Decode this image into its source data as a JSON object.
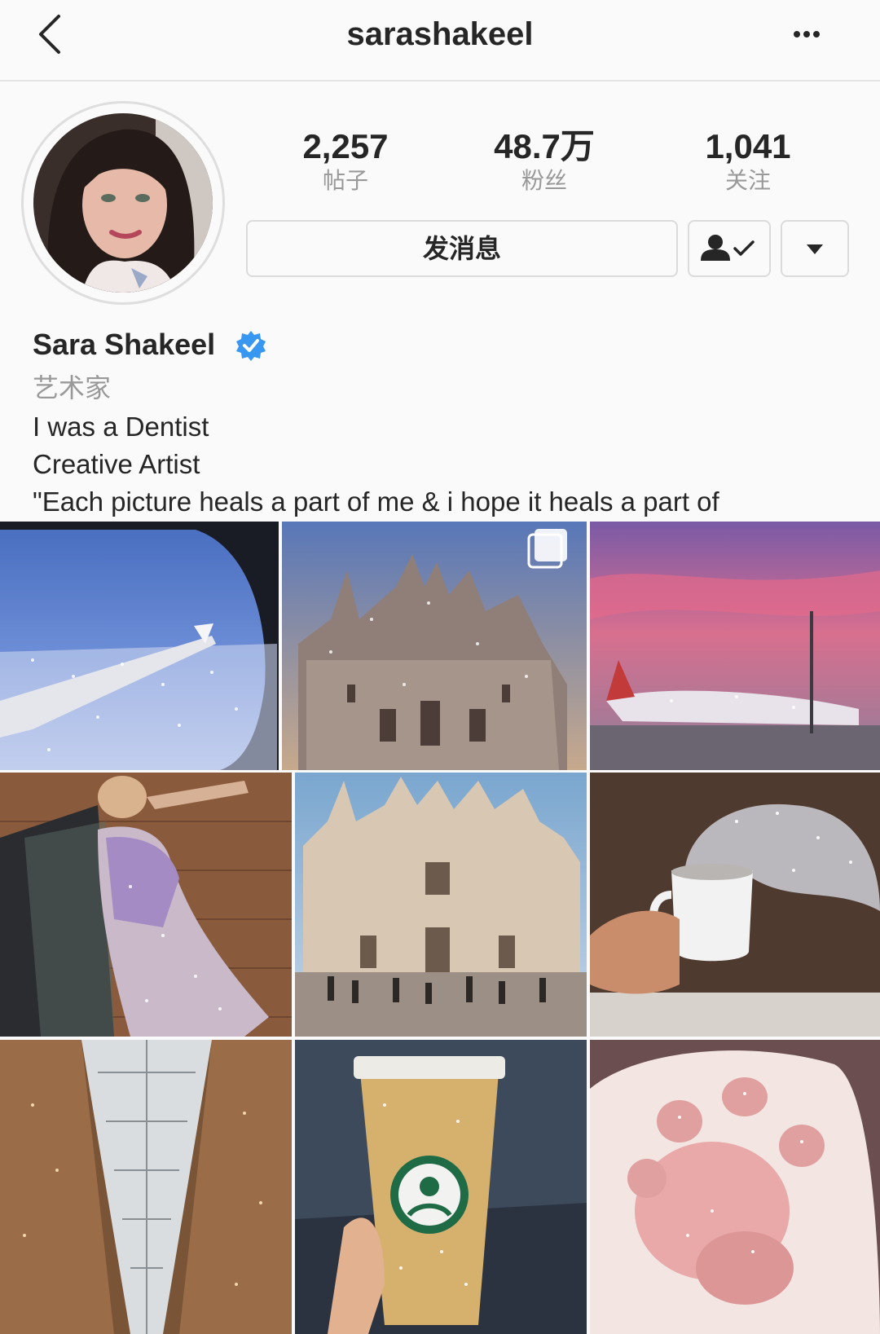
{
  "header": {
    "username": "sarashakeel",
    "back_icon": "chevron-left-icon",
    "more_icon": "more-dots-icon"
  },
  "profile": {
    "stats": [
      {
        "value": "2,257",
        "label": "帖子"
      },
      {
        "value": "48.7万",
        "label": "粉丝"
      },
      {
        "value": "1,041",
        "label": "关注"
      }
    ],
    "message_button": "发消息",
    "following_icon": "person-check-icon",
    "dropdown_icon": "triangle-down-icon",
    "full_name": "Sara Shakeel",
    "verified_icon": "verified-badge-icon",
    "category": "艺术家",
    "bio": [
      "I was a Dentist",
      "Creative Artist",
      "\"Each picture heals a part of me & i hope it heals a part of"
    ]
  },
  "grid": {
    "posts": [
      "airplane-window-glitter",
      "milan-cathedral-glitter",
      "emirates-plane-glitter",
      "glitter-bodysuit-chair",
      "duomo-square-glitter",
      "glitter-steam-mug",
      "galleria-ceiling-glitter",
      "starbucks-cup-glitter",
      "cat-paw-glitter"
    ],
    "multi_icon": "carousel-multiple-icon"
  },
  "colors": {
    "text": "#262626",
    "muted": "#999999",
    "border": "#dbdbdb",
    "verified": "#3897f0"
  }
}
